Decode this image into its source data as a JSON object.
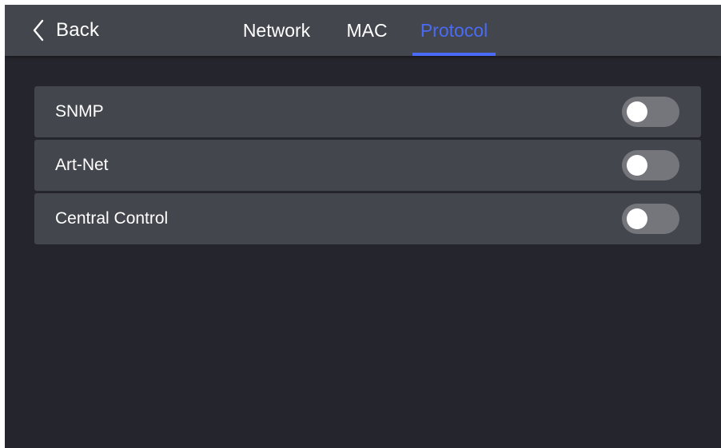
{
  "header": {
    "back_label": "Back",
    "tabs": [
      {
        "label": "Network",
        "active": false
      },
      {
        "label": "MAC",
        "active": false
      },
      {
        "label": "Protocol",
        "active": true
      }
    ]
  },
  "protocols": [
    {
      "label": "SNMP",
      "enabled": false
    },
    {
      "label": "Art-Net",
      "enabled": false
    },
    {
      "label": "Central Control",
      "enabled": false
    }
  ],
  "colors": {
    "accent": "#4a6bf5",
    "background": "#25252d",
    "panel": "#43464d",
    "toggle_off": "#74767c",
    "text": "#ffffff"
  },
  "icons": {
    "back": "chevron-left-icon"
  }
}
